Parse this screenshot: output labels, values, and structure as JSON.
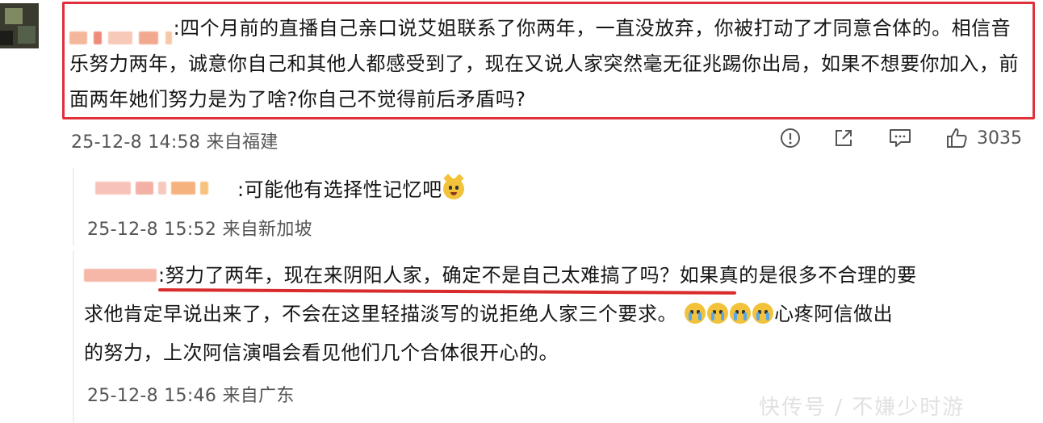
{
  "main_comment": {
    "text": ":四个月前的直播自己亲口说艾姐联系了你两年，一直没放弃，你被打动了才同意合体的。相信音乐努力两年，诚意你自己和其他人都感受到了，现在又说人家突然毫无征兆踢你出局，如果不想要你加入，前面两年她们努力是为了啥?你自己不觉得前后矛盾吗?",
    "meta": "25-12-8 14:58 来自福建",
    "like_count": "3035",
    "highlight_color": "#e0303a"
  },
  "actions": [
    {
      "icon": "info-icon"
    },
    {
      "icon": "share-icon"
    },
    {
      "icon": "comment-icon"
    },
    {
      "icon": "like-icon"
    }
  ],
  "reply_1": {
    "text": ":可能他有选择性记忆吧",
    "emoji": "cat-face-emoji",
    "meta": "25-12-8 15:52 来自新加坡"
  },
  "reply_2": {
    "line1_underlined": ":努力了两年，现在来阴阳人家，确定不是自己太难搞了吗？",
    "line1_rest": "如果真的是很多不合理的要",
    "line2_pre": "求他肯定早说出来了，不会在这里轻描淡写的说拒绝人家三个要求。",
    "line2_post": "心疼阿信做出",
    "line3": "的努力，上次阿信演唱会看见他们几个合体很开心的。",
    "emoji": "crying-face-emoji",
    "emoji_count": 4,
    "meta": "25-12-8 15:46 来自广东",
    "underline_color": "#d92b2b"
  },
  "watermark": "快传号 / 不嫌少时游"
}
